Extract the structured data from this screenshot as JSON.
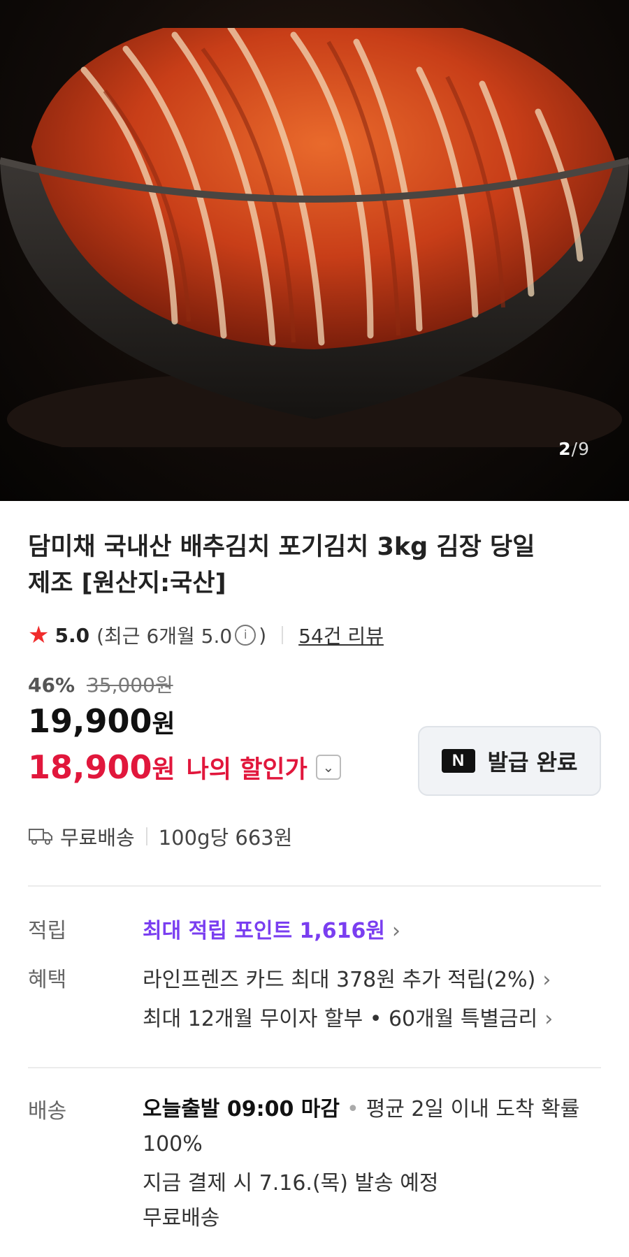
{
  "gallery": {
    "current": "2",
    "total": "9",
    "separator": "/"
  },
  "product": {
    "title": "담미채 국내산 배추김치 포기김치 3kg 김장 당일제조 [원산지:국산]",
    "rating": "5.0",
    "recent_rating": "(최근 6개월 5.0",
    "recent_rating_close": ")",
    "reviews": "54건 리뷰"
  },
  "pricing": {
    "discount_percent": "46%",
    "original_price": "35,000원",
    "price": "19,900",
    "price_unit": "원",
    "my_price": "18,900",
    "my_price_unit": "원",
    "my_price_label": "나의 할인가"
  },
  "coupon": {
    "badge": "N",
    "label": "발급 완료"
  },
  "shipping_summary": {
    "free": "무료배송",
    "unit_price": "100g당 663원"
  },
  "details": {
    "points": {
      "key": "적립",
      "value": "최대 적립 포인트 1,616원"
    },
    "benefits": {
      "key": "혜택",
      "line1": "라인프렌즈 카드 최대 378원 추가 적립(2%)",
      "line2": "최대 12개월 무이자 할부 • 60개월 특별금리"
    },
    "delivery": {
      "key": "배송",
      "deadline": "오늘출발 09:00 마감",
      "sep": "•",
      "arrival": "평균 2일 이내 도착 확률 100%",
      "ship_date": "지금 결제 시 7.16.(목) 발송 예정",
      "fee": "무료배송"
    }
  },
  "colors": {
    "discount_red": "#e1173c",
    "points_purple": "#7a3ef0",
    "star": "#f02c2c"
  }
}
